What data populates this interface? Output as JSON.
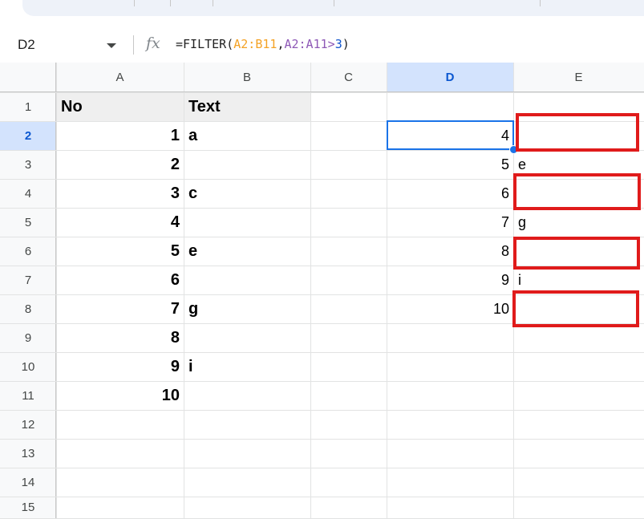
{
  "formula_bar": {
    "name_box": "D2",
    "fx_icon": "fx",
    "formula_prefix": "=FILTER(",
    "formula_range": "A2:B11",
    "formula_comma": ",",
    "formula_crit": "A2:A11>",
    "formula_num": "3",
    "formula_close": ")"
  },
  "columns": [
    "A",
    "B",
    "C",
    "D",
    "E"
  ],
  "selected_column": "D",
  "rows": [
    "1",
    "2",
    "3",
    "4",
    "5",
    "6",
    "7",
    "8",
    "9",
    "10",
    "11",
    "12",
    "13",
    "14",
    "15"
  ],
  "selected_row": "2",
  "headers": {
    "A1": "No",
    "B1": "Text"
  },
  "colA": [
    "1",
    "2",
    "3",
    "4",
    "5",
    "6",
    "7",
    "8",
    "9",
    "10"
  ],
  "colB": [
    "a",
    "",
    "c",
    "",
    "e",
    "",
    "g",
    "",
    "i",
    ""
  ],
  "colD": [
    "4",
    "5",
    "6",
    "7",
    "8",
    "9",
    "10"
  ],
  "colE": [
    "",
    "e",
    "",
    "g",
    "",
    "i",
    ""
  ],
  "colors": {
    "selection": "#1a73e8",
    "highlight_box": "#e01b1b",
    "range_ref": "#f4a225",
    "criteria_ref": "#8e59b6",
    "number": "#1155cc"
  }
}
